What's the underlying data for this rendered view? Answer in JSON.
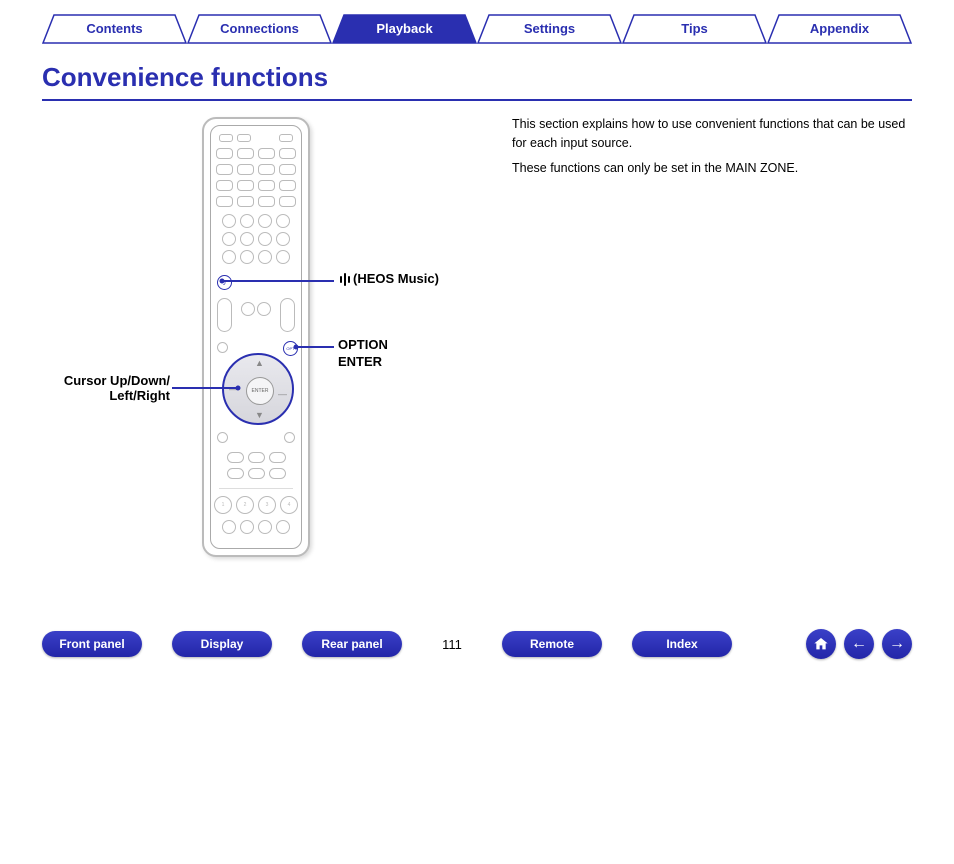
{
  "tabs": {
    "contents": "Contents",
    "connections": "Connections",
    "playback": "Playback",
    "settings": "Settings",
    "tips": "Tips",
    "appendix": "Appendix"
  },
  "heading": "Convenience functions",
  "callouts": {
    "heos": "(HEOS Music)",
    "option": "OPTION",
    "enter": "ENTER",
    "cursor_line1": "Cursor Up/Down/",
    "cursor_line2": "Left/Right"
  },
  "body_text": {
    "p1": "This section explains how to use convenient functions that can be used for each input source.",
    "p2": "These functions can only be set in the MAIN ZONE."
  },
  "bottom_nav": {
    "front_panel": "Front panel",
    "display": "Display",
    "rear_panel": "Rear panel",
    "remote": "Remote",
    "index": "Index"
  },
  "page_number": "111"
}
